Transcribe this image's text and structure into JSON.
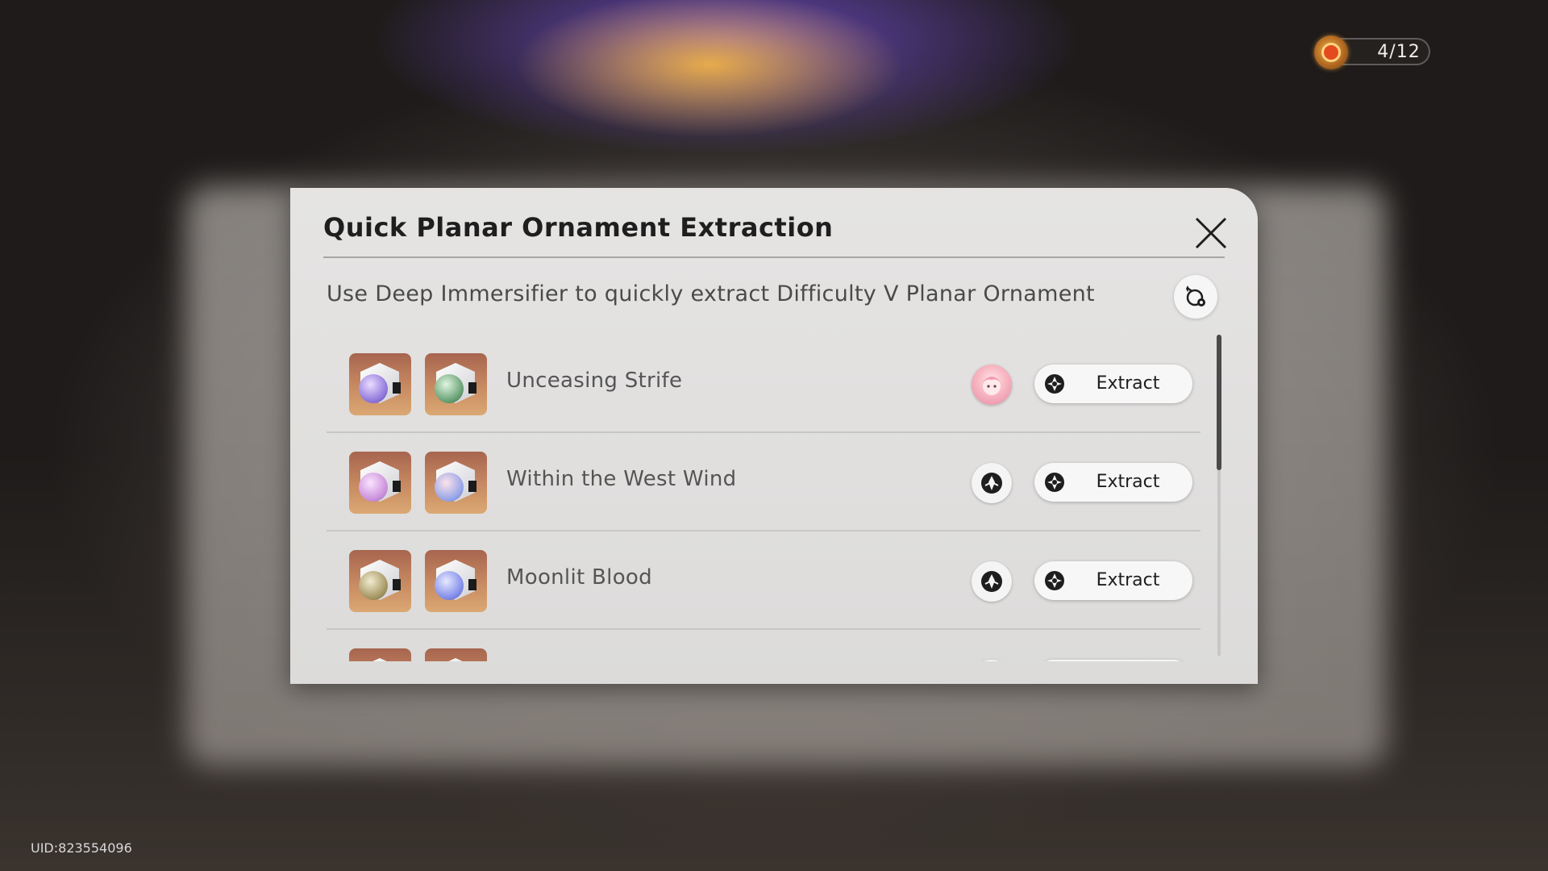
{
  "hud": {
    "counter": "4/12",
    "counter_icon": "power-orb-icon",
    "uid": "UID:823554096"
  },
  "dialog": {
    "title": "Quick Planar Ornament Extraction",
    "subtitle": "Use Deep Immersifier to quickly extract Difficulty V Planar Ornament",
    "close_icon": "close-icon",
    "filter_icon": "character-filter-icon"
  },
  "rows": [
    {
      "name": "Unceasing Strife",
      "extract_label": "Extract",
      "avatar": "character-portrait",
      "orb1": "#8a6fd8",
      "orb2": "#5f9a6c"
    },
    {
      "name": "Within the West Wind",
      "extract_label": "Extract",
      "avatar": "trailblaze-emblem",
      "orb1": "#c78bd8",
      "orb2": "#8fa0e8"
    },
    {
      "name": "Moonlit Blood",
      "extract_label": "Extract",
      "avatar": "trailblaze-emblem",
      "orb1": "#9f8f5a",
      "orb2": "#7a86e8"
    },
    {
      "name": "",
      "extract_label": "",
      "avatar": "trailblaze-emblem",
      "orb1": "#a08a7a",
      "orb2": "#a08a7a"
    }
  ]
}
